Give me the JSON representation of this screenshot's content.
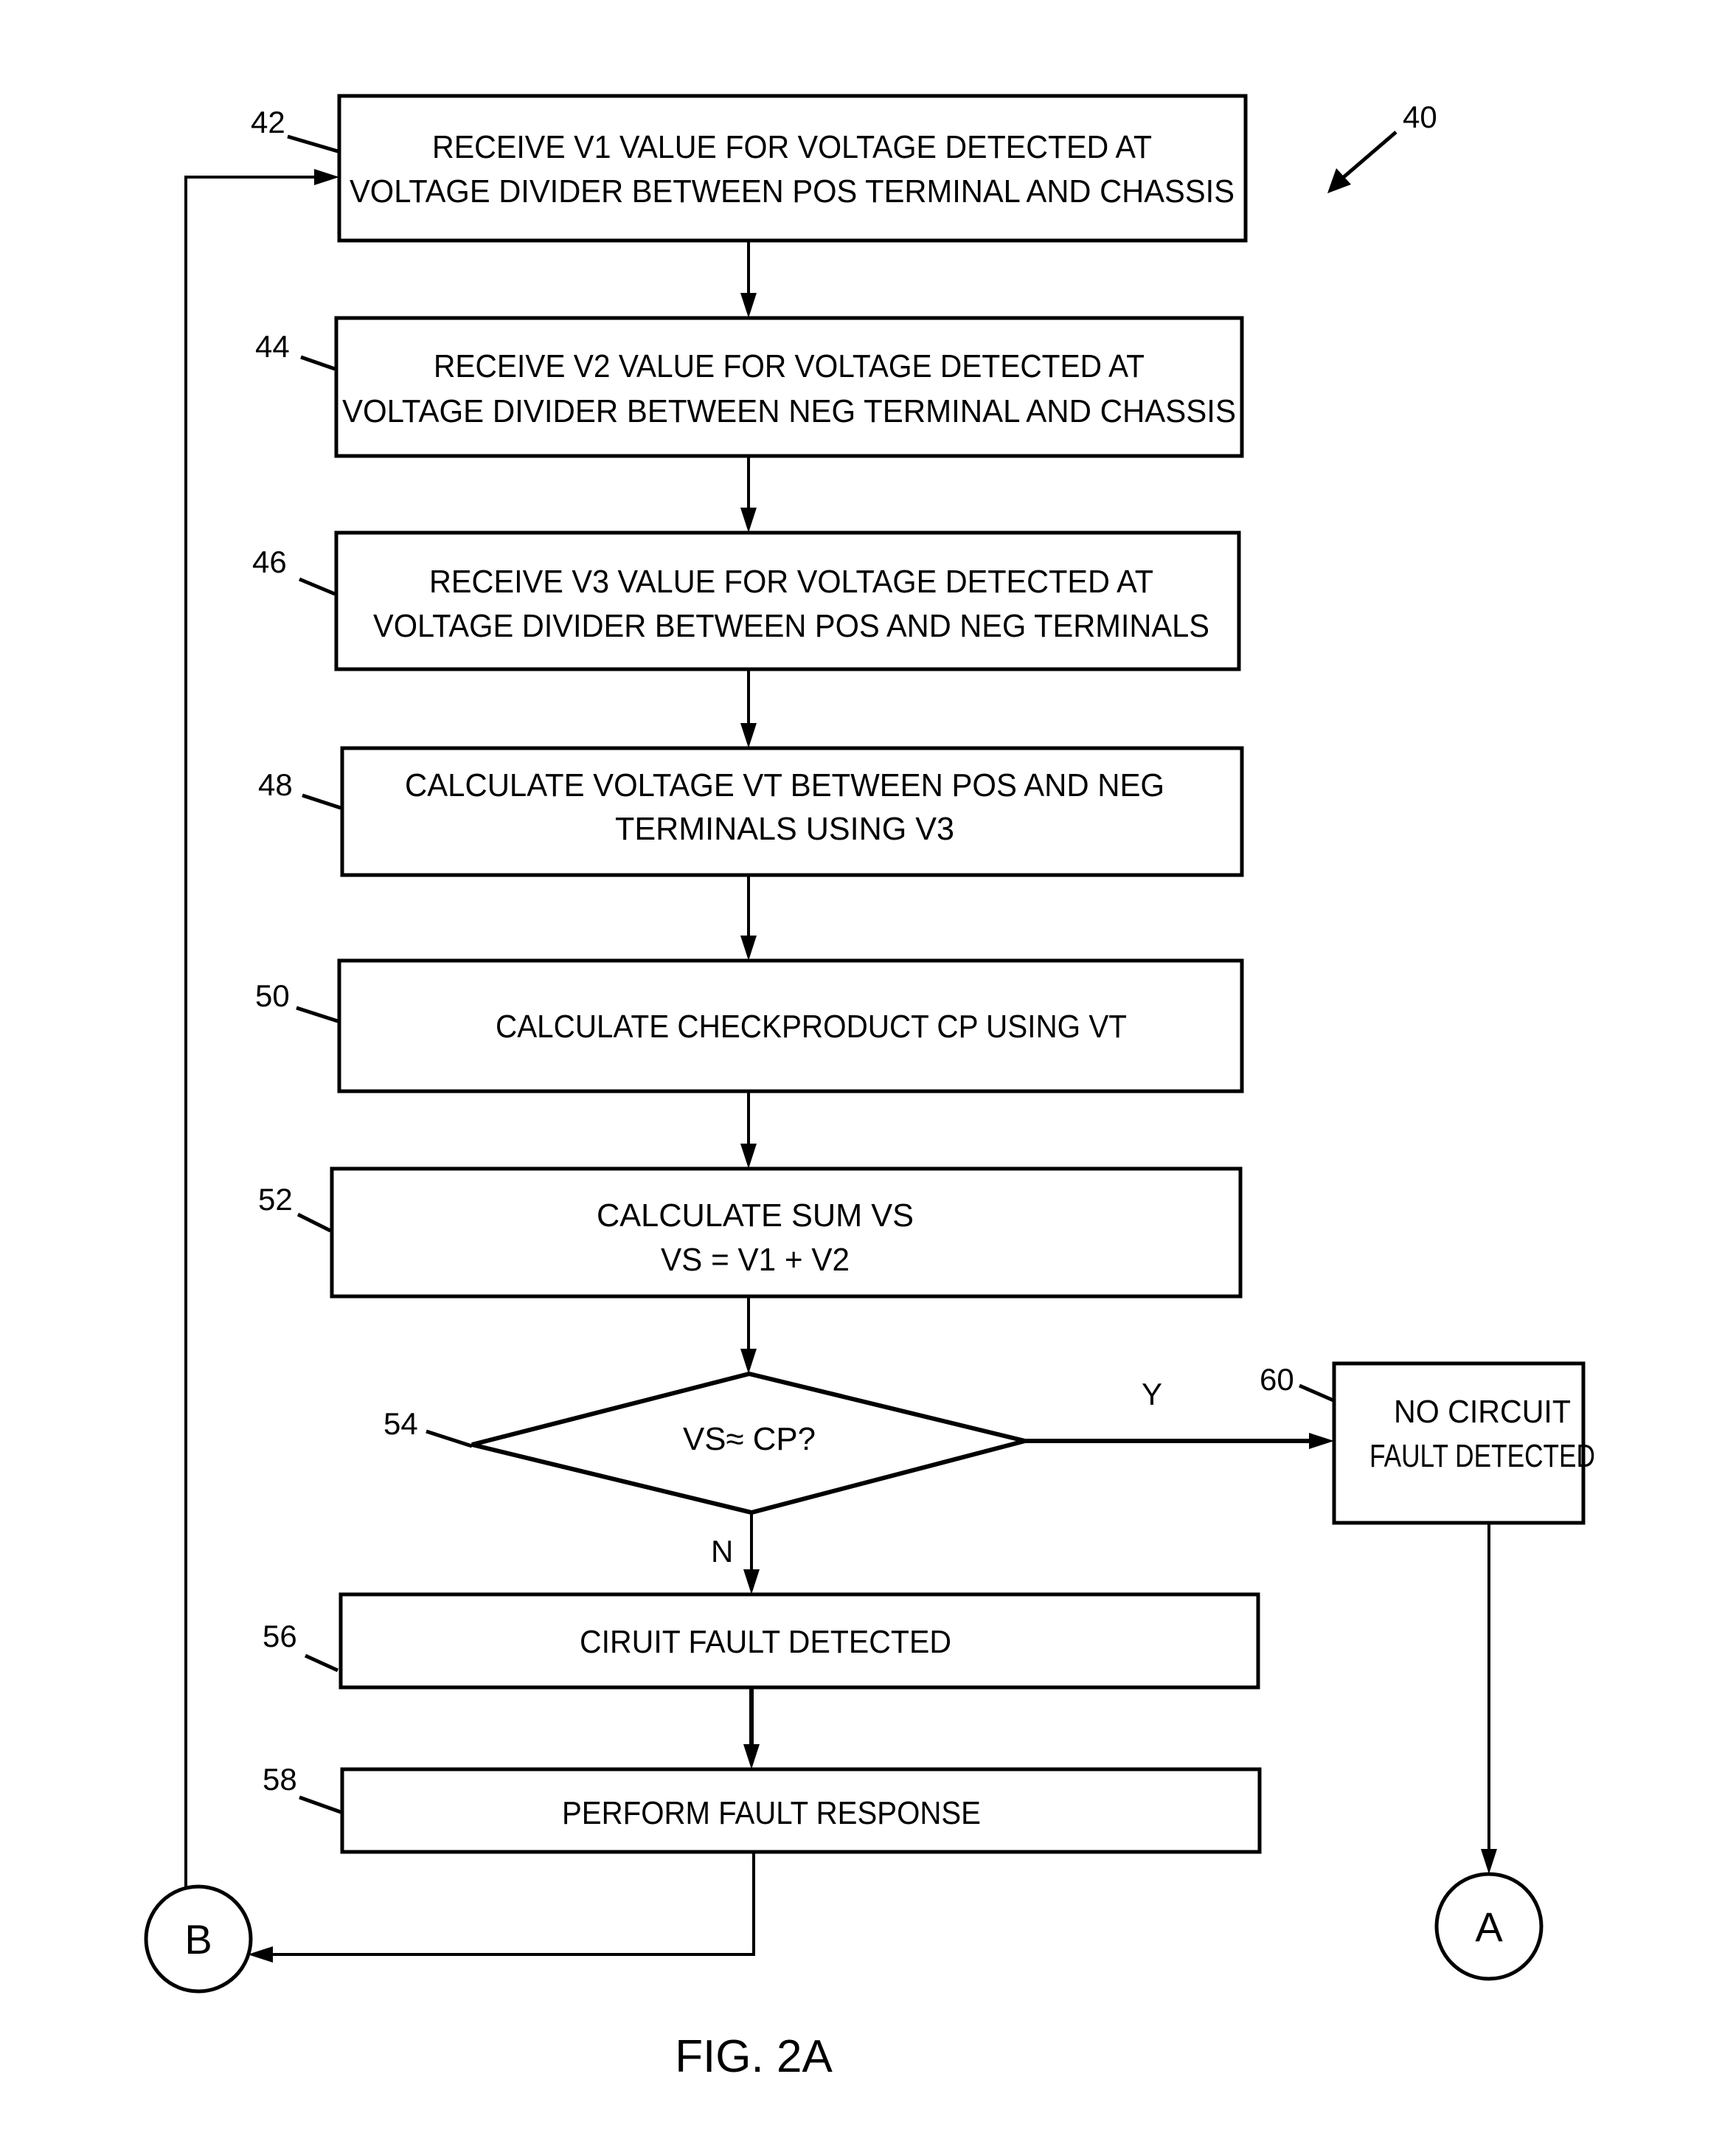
{
  "figure": {
    "caption": "FIG. 2A",
    "reference_number": "40"
  },
  "steps": [
    {
      "id": "42",
      "lines": [
        "RECEIVE  V1 VALUE FOR VOLTAGE DETECTED AT",
        "VOLTAGE DIVIDER BETWEEN POS TERMINAL AND CHASSIS"
      ]
    },
    {
      "id": "44",
      "lines": [
        "RECEIVE V2 VALUE FOR VOLTAGE DETECTED AT",
        "VOLTAGE DIVIDER BETWEEN NEG TERMINAL AND CHASSIS"
      ]
    },
    {
      "id": "46",
      "lines": [
        "RECEIVE  V3 VALUE FOR VOLTAGE DETECTED AT",
        "VOLTAGE DIVIDER BETWEEN POS AND NEG TERMINALS"
      ]
    },
    {
      "id": "48",
      "lines": [
        "CALCULATE VOLTAGE  VT BETWEEN POS AND NEG",
        "TERMINALS  USING V3"
      ]
    },
    {
      "id": "50",
      "lines": [
        "CALCULATE CHECKPRODUCT CP  USING VT"
      ]
    },
    {
      "id": "52",
      "lines": [
        "CALCULATE  SUM  VS",
        "VS = V1 + V2"
      ]
    },
    {
      "id": "56",
      "lines": [
        "CIRUIT FAULT DETECTED"
      ]
    },
    {
      "id": "58",
      "lines": [
        "PERFORM FAULT RESPONSE"
      ]
    },
    {
      "id": "60",
      "lines": [
        "NO CIRCUIT",
        "FAULT DETECTED"
      ]
    }
  ],
  "decision": {
    "id": "54",
    "question": "VS≈  CP?",
    "yes_label": "Y",
    "no_label": "N"
  },
  "connectors": {
    "a": "A",
    "b": "B"
  }
}
